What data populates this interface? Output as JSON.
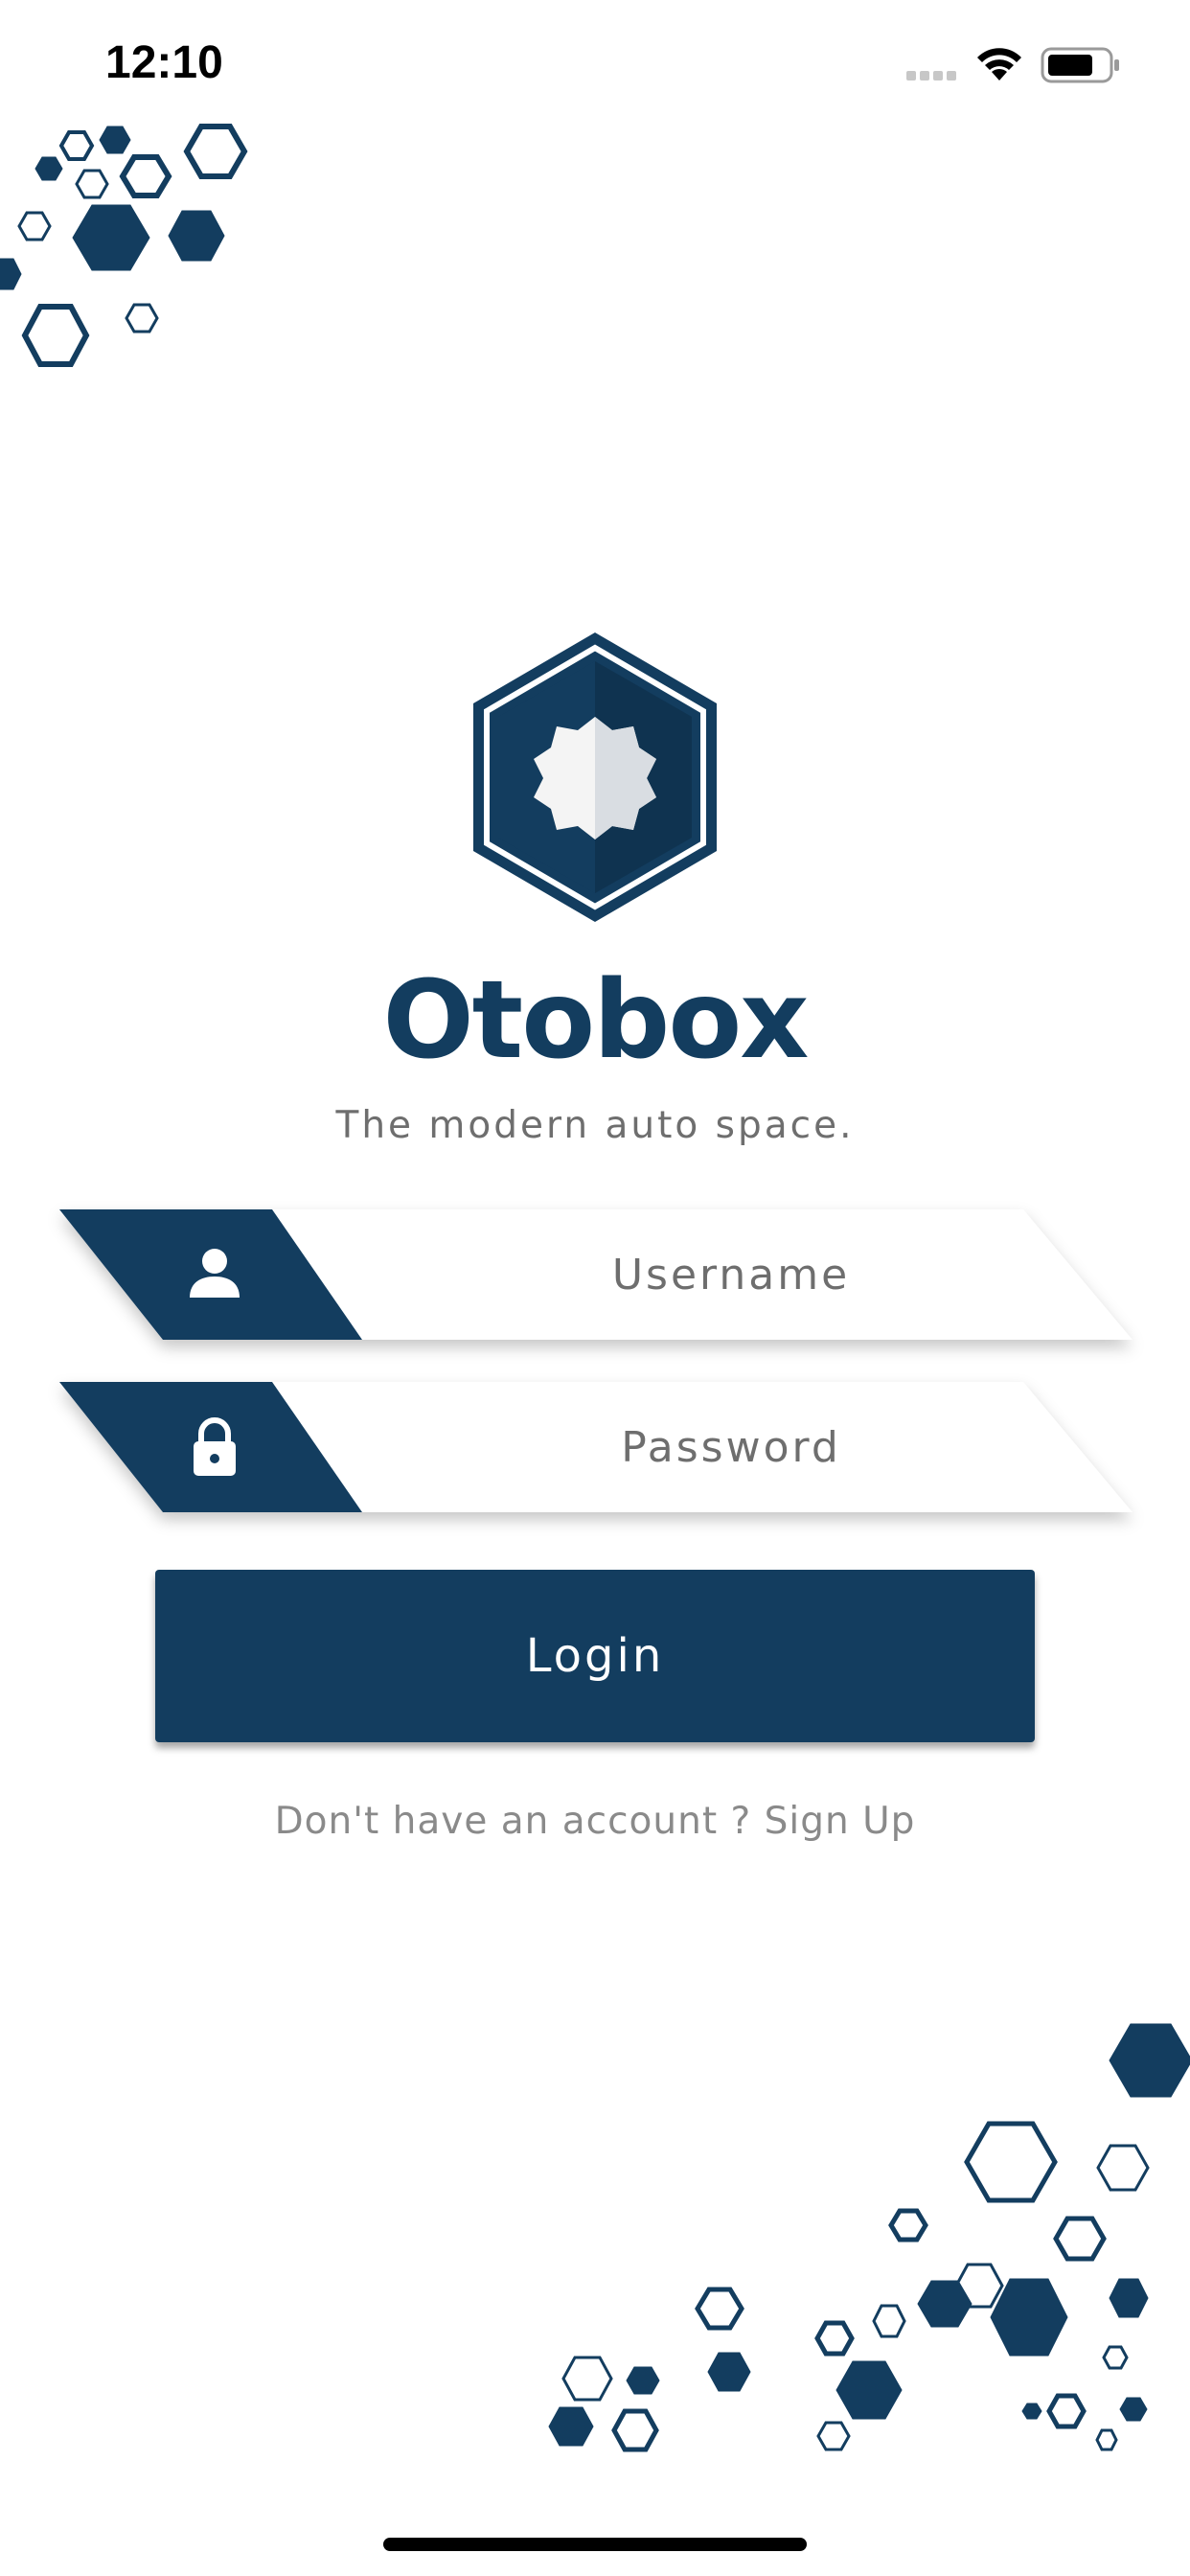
{
  "status_bar": {
    "time": "12:10",
    "signal_icon": "cellular-signal-icon",
    "wifi_icon": "wifi-icon",
    "battery_icon": "battery-icon"
  },
  "brand": {
    "logo_icon": "hexagon-gear-logo-icon",
    "title": "Otobox",
    "tagline": "The modern auto space.",
    "color": "#133d5f"
  },
  "form": {
    "username": {
      "placeholder": "Username",
      "value": "",
      "icon": "user-icon"
    },
    "password": {
      "placeholder": "Password",
      "value": "",
      "icon": "lock-icon"
    },
    "login_label": "Login",
    "signup_text": "Don't have an account ? Sign Up"
  },
  "decorations": {
    "top_left": "hexagon-pattern-decoration",
    "bottom_right": "hexagon-pattern-decoration"
  }
}
